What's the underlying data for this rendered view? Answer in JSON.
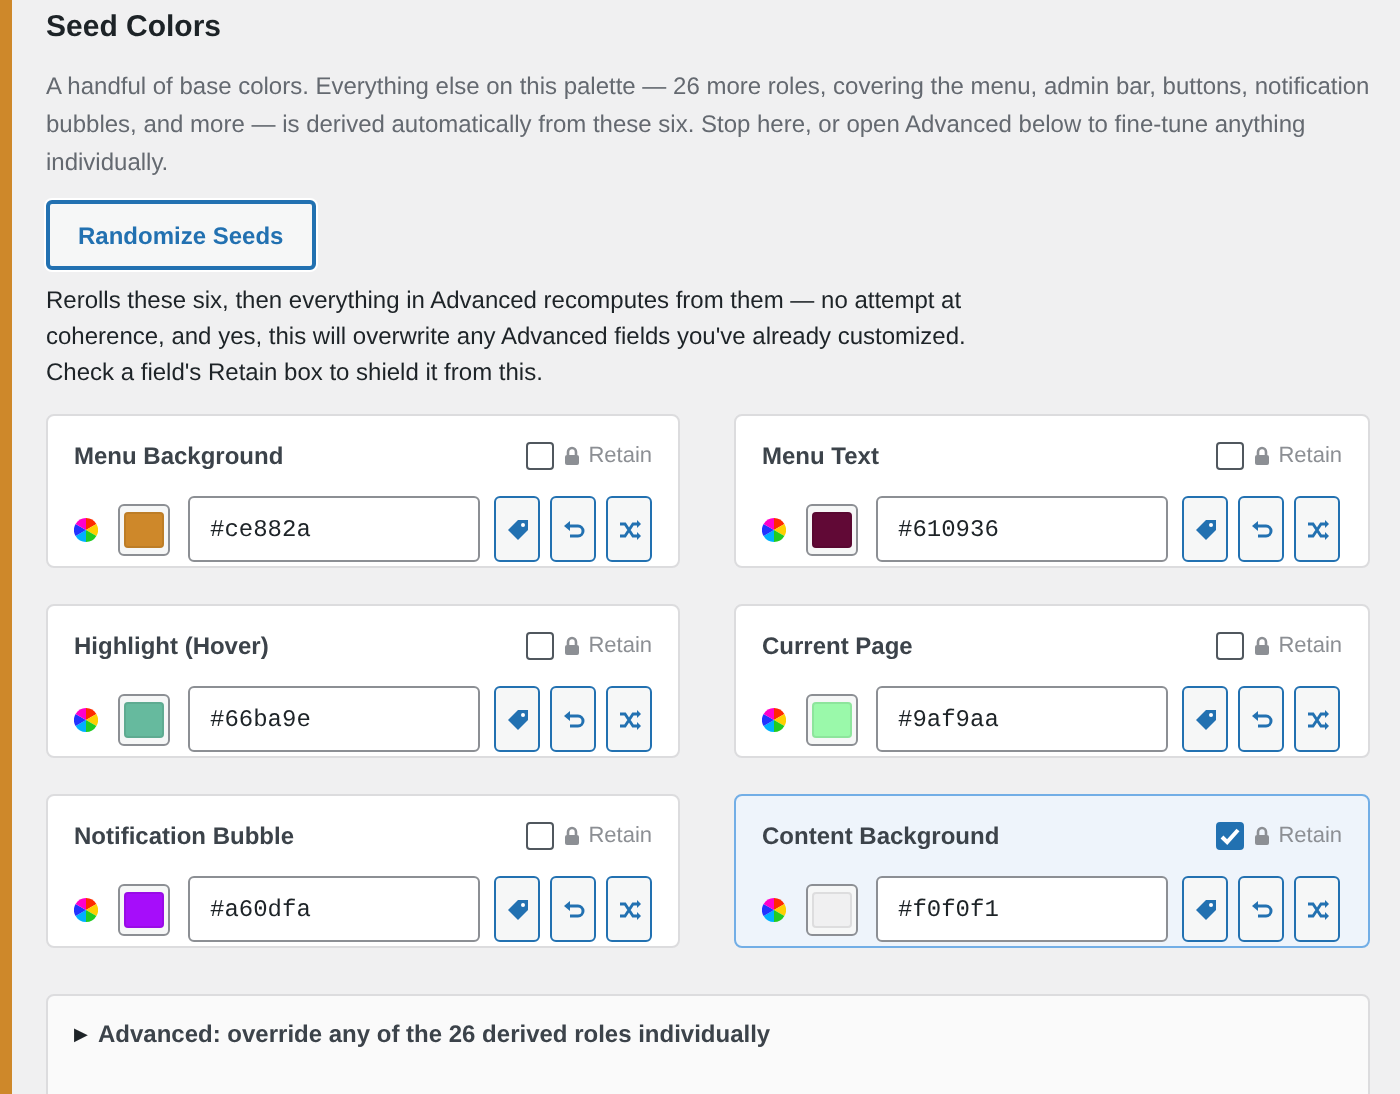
{
  "section": {
    "title": "Seed Colors",
    "description": "A handful of base colors. Everything else on this palette — 26 more roles, covering the menu, admin bar, buttons, notification bubbles, and more — is derived automatically from these six. Stop here, or open Advanced below to fine-tune anything individually."
  },
  "randomize_button": "Randomize Seeds",
  "randomize_note": "Rerolls these six, then everything in Advanced recomputes from them — no attempt at coherence, and yes, this will overwrite any Advanced fields you've already customized. Check a field's Retain box to shield it from this.",
  "seeds": [
    {
      "label": "Menu Background",
      "retain_label": "Retain",
      "retain": false,
      "value": "#ce882a"
    },
    {
      "label": "Menu Text",
      "retain_label": "Retain",
      "retain": false,
      "value": "#610936"
    },
    {
      "label": "Highlight (Hover)",
      "retain_label": "Retain",
      "retain": false,
      "value": "#66ba9e"
    },
    {
      "label": "Current Page",
      "retain_label": "Retain",
      "retain": false,
      "value": "#9af9aa"
    },
    {
      "label": "Notification Bubble",
      "retain_label": "Retain",
      "retain": false,
      "value": "#a60dfa"
    },
    {
      "label": "Content Background",
      "retain_label": "Retain",
      "retain": true,
      "value": "#f0f0f1"
    }
  ],
  "advanced": {
    "marker": "▶",
    "label": "Advanced: override any of the 26 derived roles individually"
  }
}
